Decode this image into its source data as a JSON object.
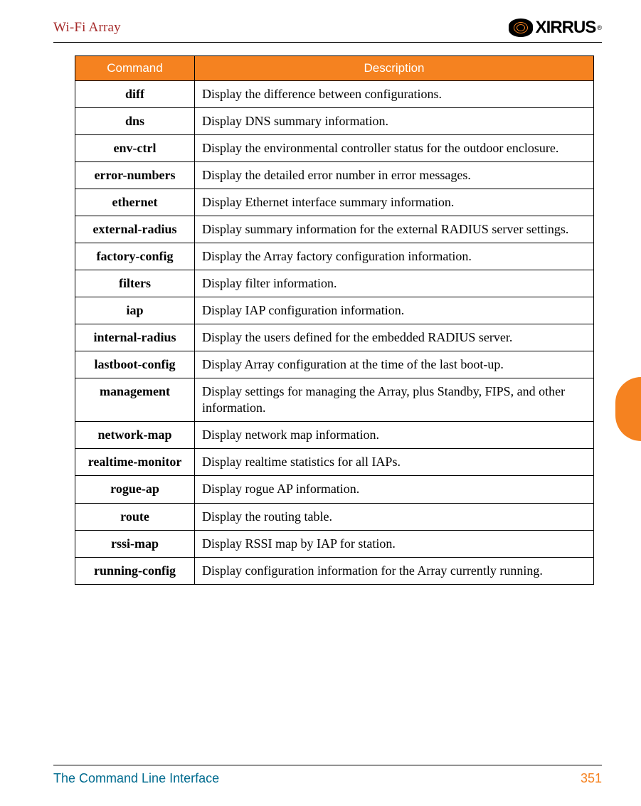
{
  "header": {
    "title": "Wi-Fi Array",
    "logo_text": "XIRRUS",
    "logo_reg": "®"
  },
  "table": {
    "headers": [
      "Command",
      "Description"
    ],
    "rows": [
      {
        "cmd": "diff",
        "desc": "Display the difference between configurations."
      },
      {
        "cmd": "dns",
        "desc": "Display DNS summary information."
      },
      {
        "cmd": "env-ctrl",
        "desc": "Display the environmental controller status for the outdoor enclosure."
      },
      {
        "cmd": "error-numbers",
        "desc": "Display the detailed error number in error messages."
      },
      {
        "cmd": "ethernet",
        "desc": "Display Ethernet interface summary information."
      },
      {
        "cmd": "external-radius",
        "desc": "Display summary information for the external RADIUS server settings."
      },
      {
        "cmd": "factory-config",
        "desc": "Display the Array factory configuration information."
      },
      {
        "cmd": "filters",
        "desc": "Display filter information."
      },
      {
        "cmd": "iap",
        "desc": "Display IAP configuration information."
      },
      {
        "cmd": "internal-radius",
        "desc": "Display the users defined for the embedded RADIUS server."
      },
      {
        "cmd": "lastboot-config",
        "desc": "Display Array configuration at the time of the last boot-up."
      },
      {
        "cmd": "management",
        "desc": "Display settings for managing the Array, plus Standby, FIPS, and other information."
      },
      {
        "cmd": "network-map",
        "desc": "Display network map information."
      },
      {
        "cmd": "realtime-monitor",
        "desc": "Display realtime statistics for all IAPs."
      },
      {
        "cmd": "rogue-ap",
        "desc": "Display rogue AP information."
      },
      {
        "cmd": "route",
        "desc": "Display the routing table."
      },
      {
        "cmd": "rssi-map",
        "desc": "Display RSSI map by IAP for station."
      },
      {
        "cmd": "running-config",
        "desc": "Display configuration information for the Array currently running."
      }
    ]
  },
  "footer": {
    "section": "The Command Line Interface",
    "page": "351"
  }
}
